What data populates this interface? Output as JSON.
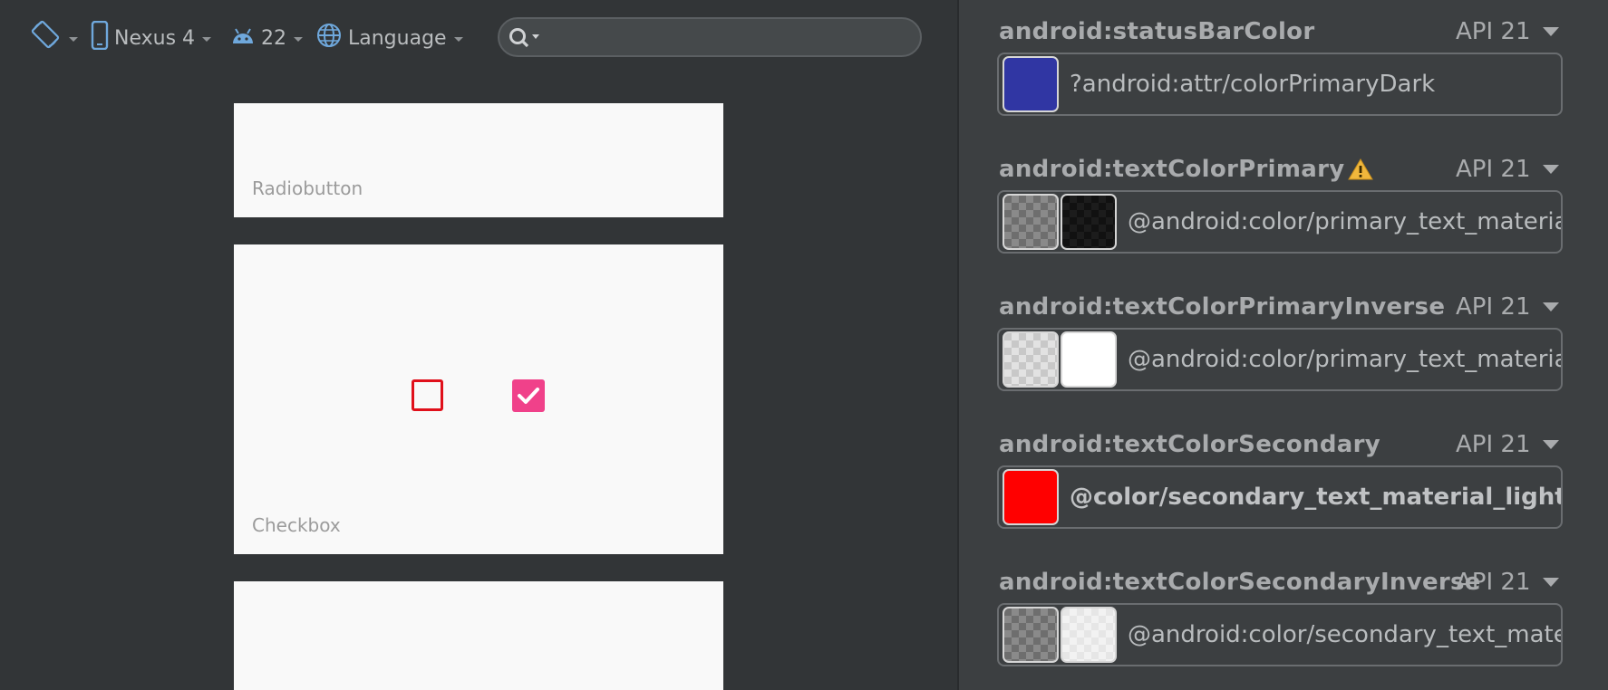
{
  "toolbar": {
    "orientation_icon": "rotate-device-icon",
    "device_label": "Nexus 4",
    "api_label": "22",
    "language_label": "Language",
    "search_placeholder": ""
  },
  "preview": {
    "cards": [
      {
        "label": "Radiobutton"
      },
      {
        "label": "Checkbox"
      },
      {
        "label": ""
      }
    ]
  },
  "attributes": [
    {
      "name": "android:statusBarColor",
      "api": "API 21",
      "value": "?android:attr/colorPrimaryDark",
      "bold": false,
      "swatches": [
        "#3036a3"
      ],
      "warning": false
    },
    {
      "name": "android:textColorPrimary",
      "api": "API 21",
      "value": "@android:color/primary_text_material_light",
      "bold": false,
      "swatches": [
        "checker-dark",
        "checker-black"
      ],
      "warning": true
    },
    {
      "name": "android:textColorPrimaryInverse",
      "api": "API 21",
      "value": "@android:color/primary_text_material_dark",
      "bold": false,
      "swatches": [
        "checker-light",
        "#ffffff"
      ],
      "warning": false
    },
    {
      "name": "android:textColorSecondary",
      "api": "API 21",
      "value": "@color/secondary_text_material_light",
      "bold": true,
      "swatches": [
        "#ff0000"
      ],
      "warning": false
    },
    {
      "name": "android:textColorSecondaryInverse",
      "api": "API 21",
      "value": "@android:color/secondary_text_material_dark",
      "bold": false,
      "swatches": [
        "checker-dark",
        "checker-white-light"
      ],
      "warning": false
    }
  ],
  "colors": {
    "checkbox_unchecked": "#e0101b",
    "checkbox_checked": "#f0418a",
    "accent_blue": "#6fa8dc"
  }
}
